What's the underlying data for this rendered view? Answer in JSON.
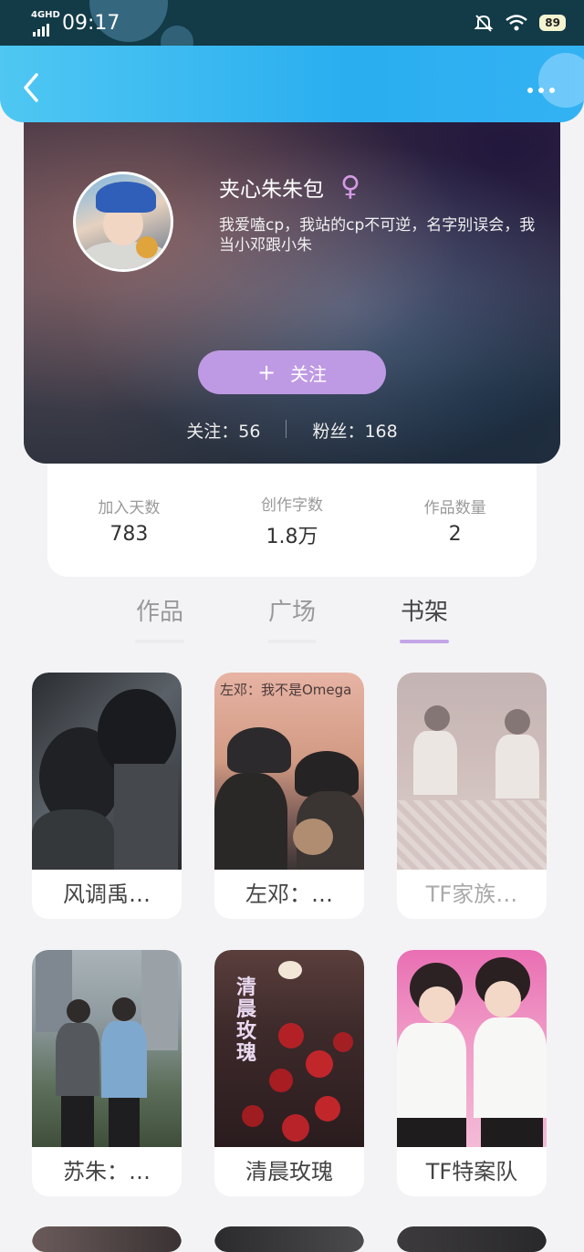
{
  "status_bar": {
    "network": "4GHD",
    "time": "09:17",
    "battery": "89"
  },
  "header": {
    "back_icon": "chevron-left-icon",
    "more_icon": "more-horizontal-icon"
  },
  "profile": {
    "nickname": "夹心朱朱包",
    "gender_symbol": "♀",
    "bio": "我爱嗑cp，我站的cp不可逆，名字别误会，我当小邓跟小朱",
    "follow_button": "关注",
    "follow_plus": "+",
    "following": "关注：56",
    "fans": "粉丝：168"
  },
  "stats": [
    {
      "label": "加入天数",
      "value": "783"
    },
    {
      "label": "创作字数",
      "value": "1.8万"
    },
    {
      "label": "作品数量",
      "value": "2"
    }
  ],
  "tabs": [
    {
      "label": "作品",
      "active": false
    },
    {
      "label": "广场",
      "active": false
    },
    {
      "label": "书架",
      "active": true
    }
  ],
  "books": [
    {
      "title": "风调禹…",
      "faded": false
    },
    {
      "title": "左邓：…",
      "cover_text": "左邓：我不是Omega",
      "faded": false
    },
    {
      "title": "TF家族…",
      "faded": true
    },
    {
      "title": "苏朱：…",
      "faded": false
    },
    {
      "title": "清晨玫瑰",
      "cover_text": "清晨玫瑰",
      "faded": false
    },
    {
      "title": "TF特案队",
      "faded": false
    }
  ],
  "colors": {
    "header_blue": "#2aaef0",
    "accent_purple": "#c4a5e6",
    "follow_button": "#bf9ae4"
  }
}
